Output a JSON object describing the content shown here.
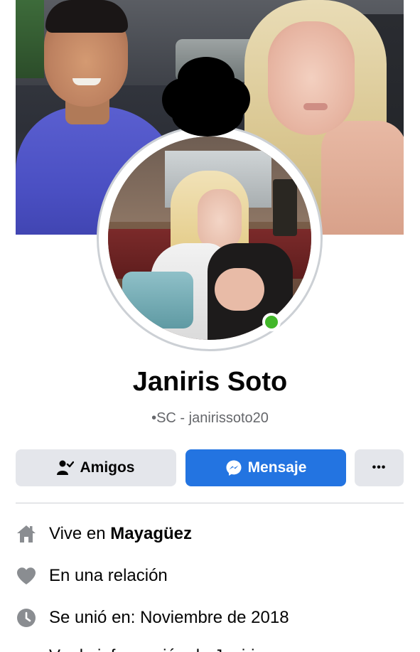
{
  "profile": {
    "name": "Janiris Soto",
    "subtitle": "•SC - janirissoto20",
    "online": true
  },
  "actions": {
    "friends_label": "Amigos",
    "message_label": "Mensaje",
    "more_label": "•••"
  },
  "intro": [
    {
      "icon": "home-icon",
      "prefix": "Vive en ",
      "value": "Mayagüez"
    },
    {
      "icon": "heart-icon",
      "prefix": "En una relación",
      "value": ""
    },
    {
      "icon": "clock-icon",
      "prefix": "Se unió en: Noviembre de 2018",
      "value": ""
    },
    {
      "icon": "more-info-icon",
      "prefix": "Ver la información de Janiris",
      "value": ""
    }
  ],
  "colors": {
    "primary_button": "#2374e1",
    "secondary_button": "#e4e6eb",
    "online_status": "#42b72a",
    "icon_gray": "#8a8d91",
    "muted_text": "#65676b"
  }
}
